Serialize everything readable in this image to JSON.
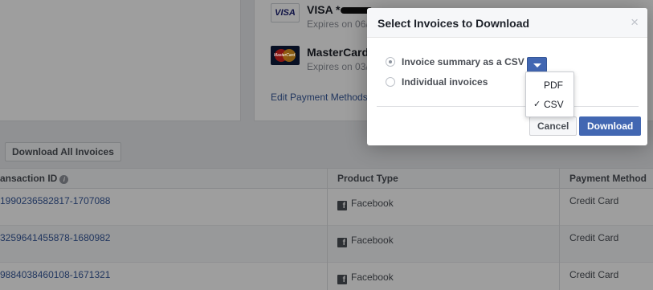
{
  "payment_methods": [
    {
      "brand": "VISA",
      "name": "VISA *",
      "expiry": "Expires on 06/"
    },
    {
      "brand": "MasterCard",
      "name": "MasterCard",
      "expiry": "Expires on 03/"
    }
  ],
  "edit_payment_methods": "Edit Payment Methods",
  "download_all_label": "Download All Invoices",
  "table": {
    "columns": [
      "ansaction ID",
      "Product Type",
      "Payment Method"
    ],
    "rows": [
      {
        "id": "1990236582817-1707088",
        "product": "Facebook",
        "payment": "Credit Card"
      },
      {
        "id": "3259641455878-1680982",
        "product": "Facebook",
        "payment": "Credit Card"
      },
      {
        "id": "9884038460108-1671321",
        "product": "Facebook",
        "payment": "Credit Card"
      }
    ]
  },
  "modal": {
    "title": "Select Invoices to Download",
    "close": "×",
    "options": [
      {
        "label": "Invoice summary as a CSV",
        "selected": true
      },
      {
        "label": "Individual invoices",
        "selected": false
      }
    ],
    "cancel_label": "Cancel",
    "download_label": "Download"
  },
  "format_dropdown": {
    "items": [
      {
        "label": "PDF",
        "checked": false,
        "check": ""
      },
      {
        "label": "CSV",
        "checked": true,
        "check": "✓"
      }
    ]
  },
  "icons": {
    "info": "i",
    "facebook": "f",
    "mastercard_logo_text": "MasterCard"
  },
  "colors": {
    "link": "#365899",
    "primary_button": "#4267b2"
  }
}
